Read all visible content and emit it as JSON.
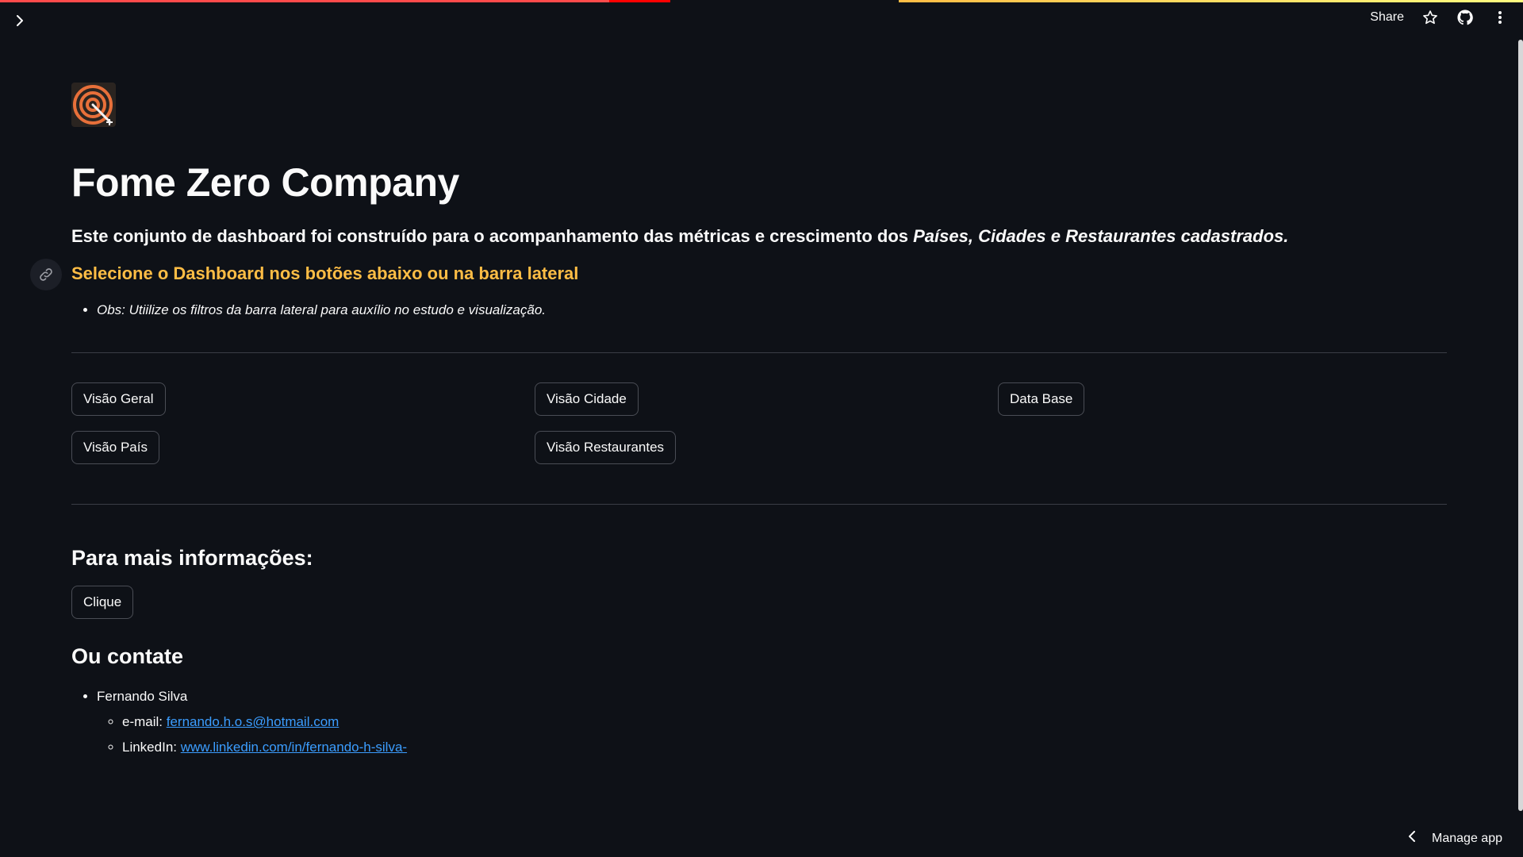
{
  "header": {
    "share_label": "Share",
    "icons": [
      "expand-sidebar-icon",
      "star-icon",
      "github-icon",
      "more-options-icon"
    ]
  },
  "main": {
    "logo_icon": "target-icon",
    "title": "Fome Zero Company",
    "subtitle_prefix": "Este conjunto de dashboard foi construído para o acompanhamento das métricas e crescimento dos ",
    "subtitle_emph": "Países, Cidades e Restaurantes cadastrados.",
    "select_heading": "Selecione o Dashboard nos botões abaixo ou na barra lateral",
    "obs_note": "Obs: Utiilize os filtros da barra lateral para auxílio no estudo e visualização.",
    "buttons": {
      "visao_geral": "Visão Geral",
      "visao_cidade": "Visão Cidade",
      "data_base": "Data Base",
      "visao_pais": "Visão País",
      "visao_restaurantes": "Visão Restaurantes"
    },
    "more_info_heading": "Para mais informações:",
    "clique_label": "Clique",
    "contact_heading": "Ou contate",
    "contact": {
      "name": "Fernando Silva",
      "email_label": "e-mail: ",
      "email": "fernando.h.o.s@hotmail.com",
      "linkedin_label": "LinkedIn: ",
      "linkedin": "www.linkedin.com/in/fernando-h-silva-"
    }
  },
  "footer": {
    "manage_label": "Manage app"
  },
  "colors": {
    "background": "#0e1117",
    "accent_orange": "#ffbd45",
    "link_blue": "#3b9dff",
    "text": "#fafafa"
  }
}
